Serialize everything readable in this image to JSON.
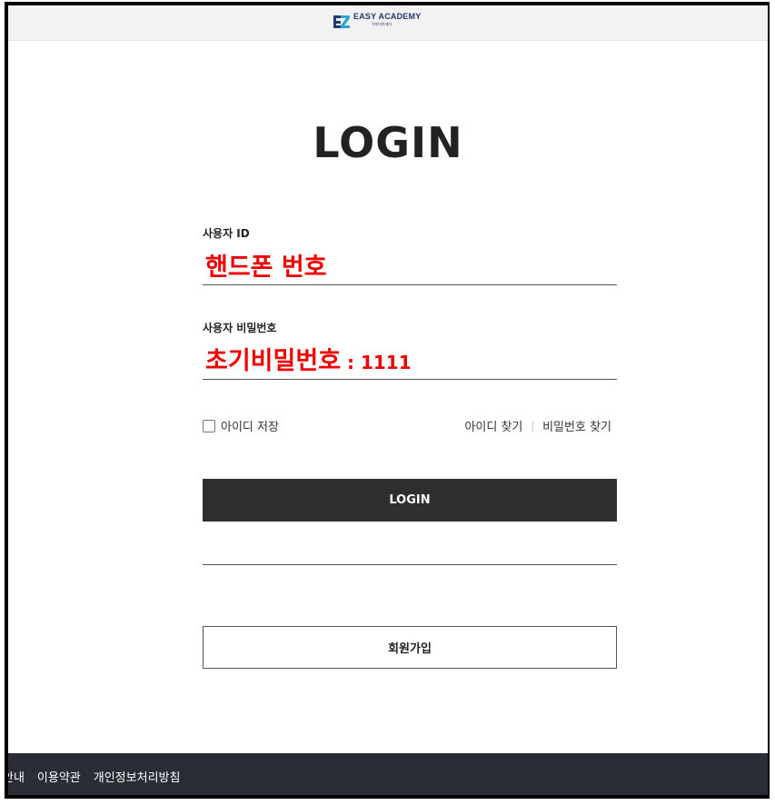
{
  "brand": {
    "name": "EASY ACADEMY",
    "subtitle": "이지아카데미"
  },
  "page_title": "LOGIN",
  "user_id": {
    "label": "사용자 ID",
    "value": "핸드폰 번호"
  },
  "password": {
    "label": "사용자 비밀번호",
    "value": "초기비밀번호",
    "value_suffix": " : 1111"
  },
  "remember": {
    "label": "아이디 저장",
    "checked": false
  },
  "links": {
    "find_id": "아이디 찾기",
    "separator": "|",
    "find_password": "비밀번호 찾기"
  },
  "buttons": {
    "login": "LOGIN",
    "signup": "회원가입"
  },
  "footer": {
    "links": [
      "안내",
      "이용약관",
      "개인정보처리방침"
    ]
  },
  "colors": {
    "accent_text": "#ee0000",
    "login_button": "#2f2f2f",
    "footer_bg": "#2b2d36",
    "brand": "#1f3a6b"
  }
}
